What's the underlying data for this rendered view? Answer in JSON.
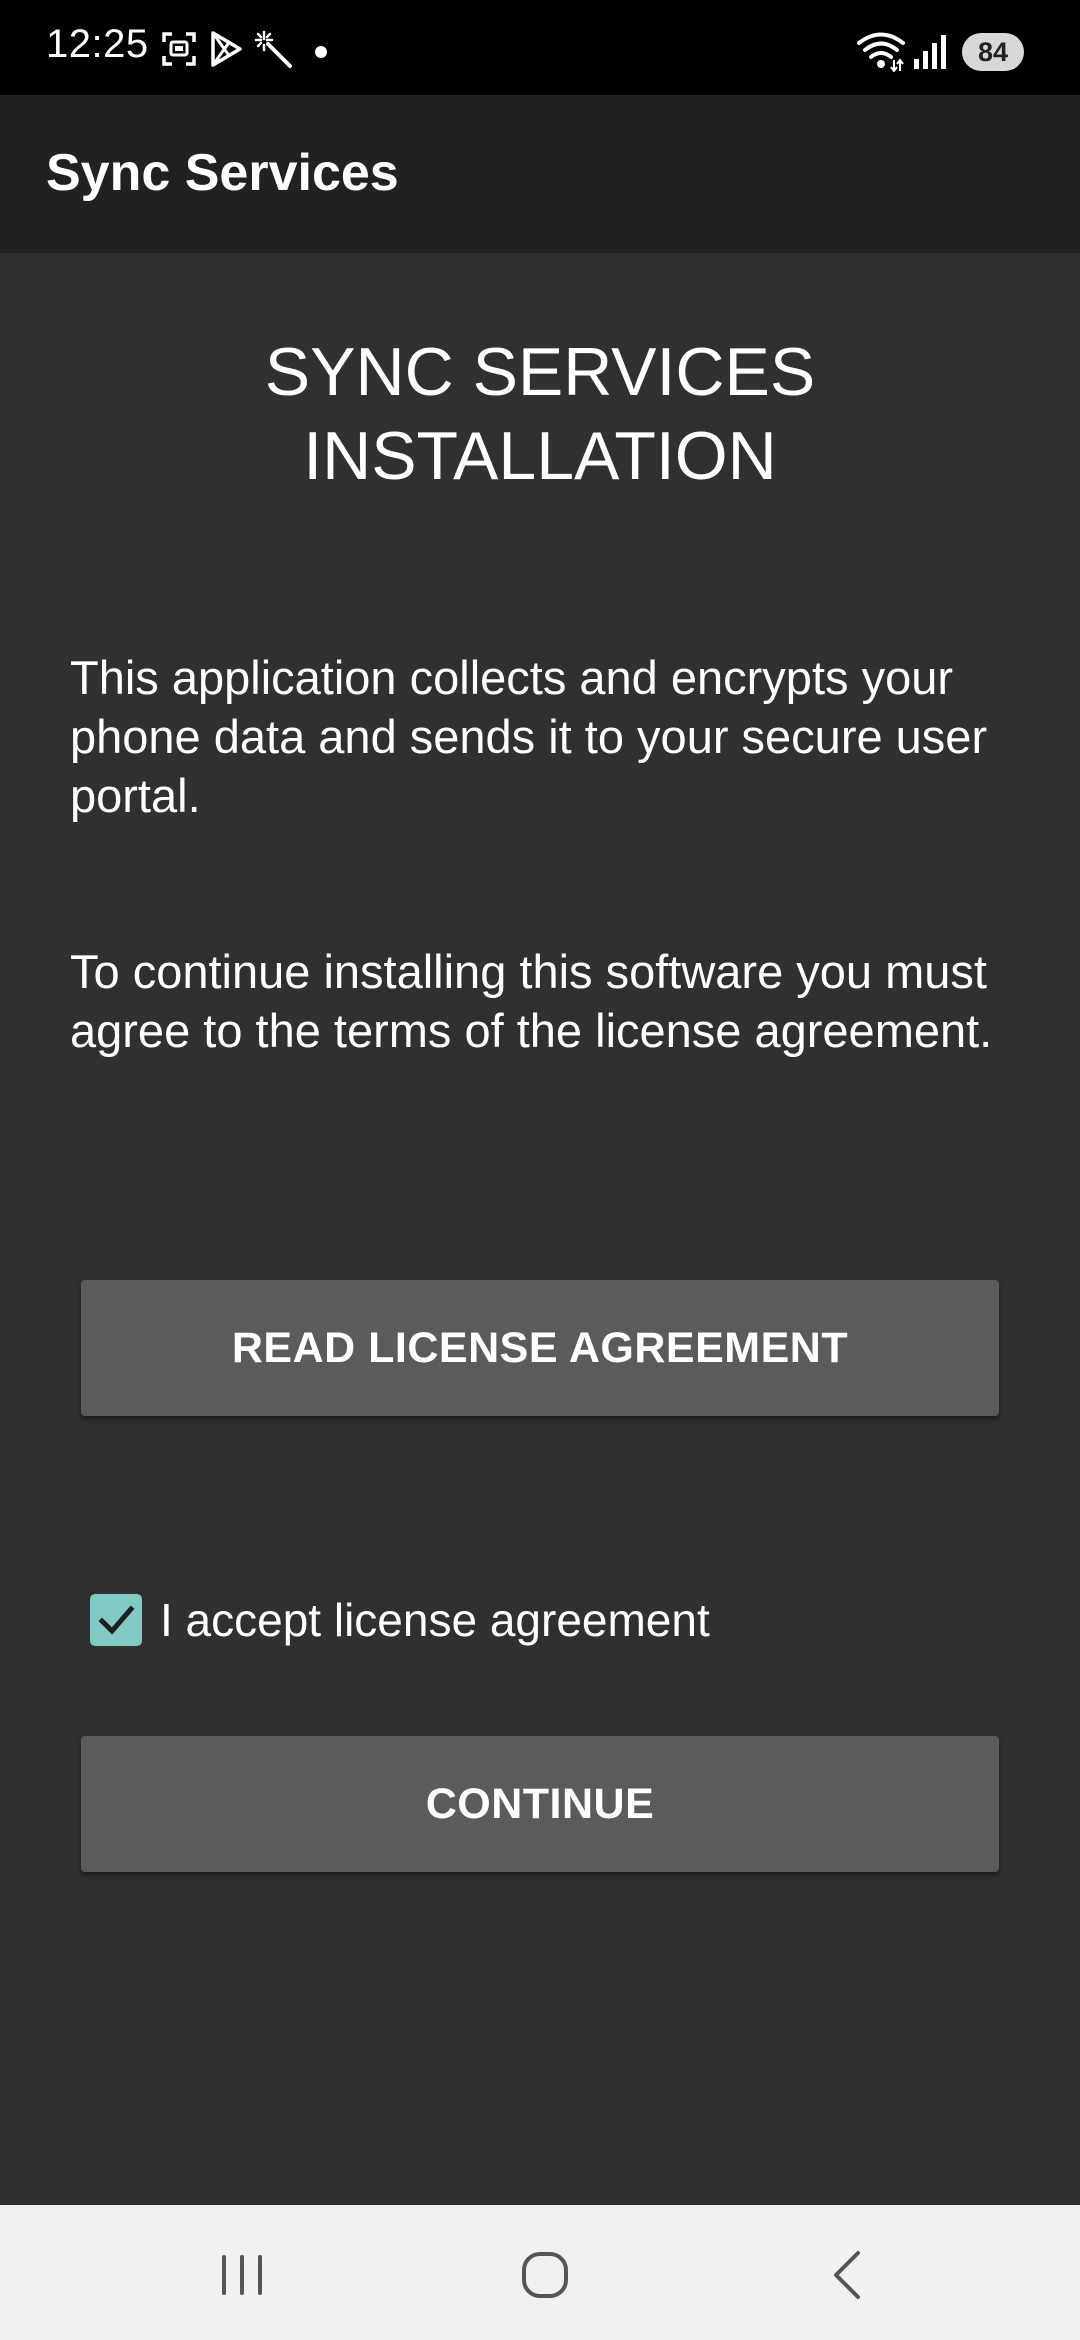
{
  "status_bar": {
    "time": "12:25",
    "battery": "84",
    "icons": [
      "screenshot-icon",
      "play-store-icon",
      "magic-wand-icon",
      "notification-dot-icon",
      "wifi-icon",
      "signal-icon",
      "battery-icon"
    ]
  },
  "app_bar": {
    "title": "Sync Services"
  },
  "main": {
    "heading_line1": "SYNC SERVICES",
    "heading_line2": "INSTALLATION",
    "paragraph1": "This application collects and encrypts your phone data and sends it to your secure user portal.",
    "paragraph2": "To continue installing this software you must agree to the terms of the license agreement.",
    "read_license_label": "READ LICENSE AGREEMENT",
    "accept_checkbox_label": "I accept license agreement",
    "accept_checked": true,
    "continue_label": "CONTINUE"
  },
  "nav_bar": {
    "icons": [
      "recent-apps-icon",
      "home-icon",
      "back-icon"
    ]
  },
  "colors": {
    "background": "#303030",
    "app_bar": "#212121",
    "status_bar": "#000000",
    "button": "#5b5b5d",
    "checkbox_accent": "#80cbc4",
    "nav_bar": "#f1f1f3"
  }
}
